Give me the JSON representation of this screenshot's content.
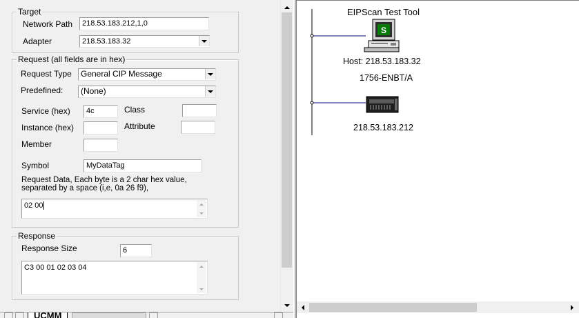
{
  "target": {
    "title": "Target",
    "network_path_label": "Network Path",
    "network_path_value": "218.53.183.212,1,0",
    "adapter_label": "Adapter",
    "adapter_value": "218.53.183.32"
  },
  "request": {
    "title": "Request (all fields are in hex)",
    "request_type_label": "Request Type",
    "request_type_value": "General CIP Message",
    "predefined_label": "Predefined:",
    "predefined_value": "(None)",
    "service_label": "Service (hex)",
    "service_value": "4c",
    "class_label": "Class",
    "class_value": "",
    "instance_label": "Instance (hex)",
    "instance_value": "",
    "attribute_label": "Attribute",
    "attribute_value": "",
    "member_label": "Member",
    "member_value": "",
    "symbol_label": "Symbol",
    "symbol_value": "MyDataTag",
    "request_data_hint_line1": "Request Data, Each byte is a 2 char hex value,",
    "request_data_hint_line2": "separated by a space (i,e, 0a 26 f9),",
    "request_data_value": "02 00"
  },
  "response": {
    "title": "Response",
    "size_label": "Response Size",
    "size_value": "6",
    "data_value": "C3 00 01 02 03 04"
  },
  "tabs": {
    "active_label": "UCMM"
  },
  "network_view": {
    "tool_label": "EIPScan Test Tool",
    "host_label": "Host: 218.53.183.32",
    "device_model": "1756-ENBT/A",
    "device_ip": "218.53.183.212",
    "line_color": "#00007f"
  }
}
